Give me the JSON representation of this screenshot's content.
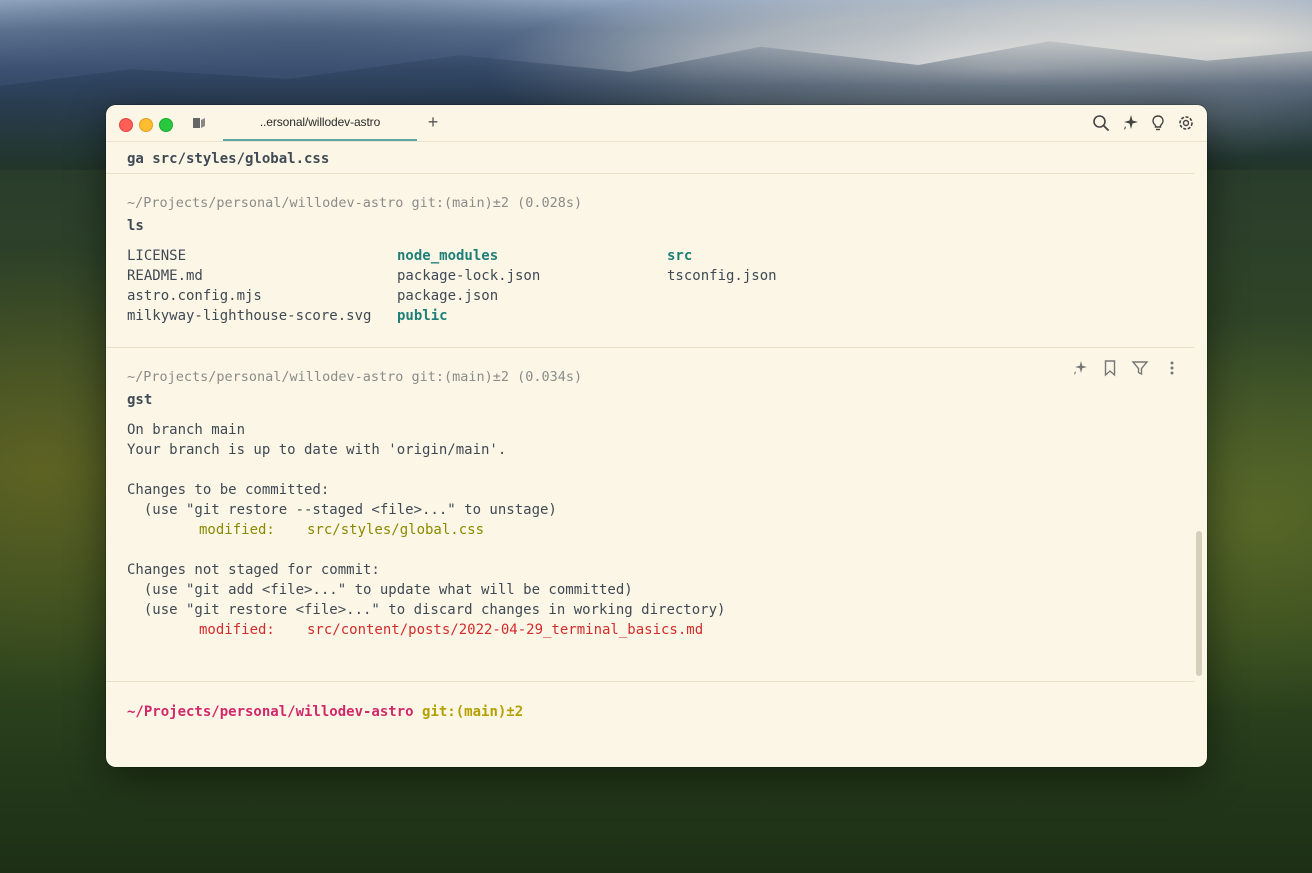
{
  "tab": {
    "label": "..ersonal/willodev-astro",
    "new_tab": "+"
  },
  "blocks": [
    {
      "command": "ga src/styles/global.css"
    },
    {
      "prompt": "~/Projects/personal/willodev-astro git:(main)±2 (0.028s)",
      "command": "ls",
      "files": [
        {
          "name": "LICENSE",
          "type": "file"
        },
        {
          "name": "README.md",
          "type": "file"
        },
        {
          "name": "astro.config.mjs",
          "type": "file"
        },
        {
          "name": "milkyway-lighthouse-score.svg",
          "type": "file"
        },
        {
          "name": "node_modules",
          "type": "dir"
        },
        {
          "name": "package-lock.json",
          "type": "file"
        },
        {
          "name": "package.json",
          "type": "file"
        },
        {
          "name": "public",
          "type": "dir"
        },
        {
          "name": "src",
          "type": "dir"
        },
        {
          "name": "tsconfig.json",
          "type": "file"
        }
      ]
    },
    {
      "prompt": "~/Projects/personal/willodev-astro git:(main)±2 (0.034s)",
      "command": "gst",
      "output": {
        "l1": "On branch main",
        "l2": "Your branch is up to date with 'origin/main'.",
        "l3": "Changes to be committed:",
        "l4": "  (use \"git restore --staged <file>...\" to unstage)",
        "l5_label": "modified:",
        "l5_file": "src/styles/global.css",
        "l6": "Changes not staged for commit:",
        "l7": "  (use \"git add <file>...\" to update what will be committed)",
        "l8": "  (use \"git restore <file>...\" to discard changes in working directory)",
        "l9_label": "modified:",
        "l9_file": "src/content/posts/2022-04-29_terminal_basics.md"
      }
    }
  ],
  "current_prompt": {
    "path": "~/Projects/personal/willodev-astro",
    "git": "git:(main)±2"
  },
  "colors": {
    "accent": "#5aa7a3",
    "background": "#fcf6e6",
    "dir": "#1d7f78",
    "staged": "#8a8a00",
    "unstaged": "#d42c2c",
    "path": "#d2286a"
  },
  "icons": [
    "sidebar-toggle-icon",
    "search-icon",
    "ai-sparkle-icon",
    "lightbulb-icon",
    "settings-gear-icon",
    "bookmark-icon",
    "filter-icon",
    "more-vertical-icon"
  ]
}
